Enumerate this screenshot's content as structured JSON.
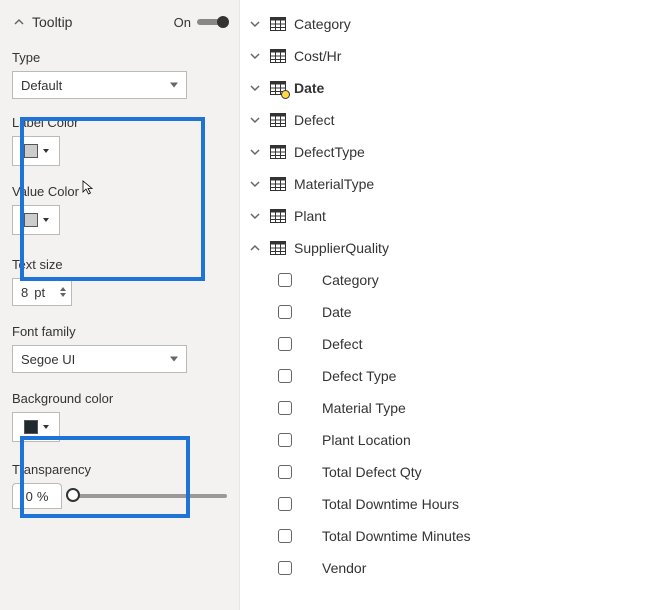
{
  "format": {
    "section_title": "Tooltip",
    "toggle_label": "On",
    "toggle_state": true,
    "type": {
      "label": "Type",
      "value": "Default"
    },
    "label_color": {
      "label": "Label Color",
      "swatch": "#cccccc"
    },
    "value_color": {
      "label": "Value Color",
      "swatch": "#cccccc"
    },
    "text_size": {
      "label": "Text size",
      "value": "8",
      "unit": "pt"
    },
    "font_family": {
      "label": "Font family",
      "value": "Segoe UI"
    },
    "background_color": {
      "label": "Background color",
      "swatch": "#1e2a2f"
    },
    "transparency": {
      "label": "Transparency",
      "value": "0",
      "unit": "%"
    }
  },
  "tables": [
    {
      "name": "Category",
      "expanded": false,
      "highlighted": false
    },
    {
      "name": "Cost/Hr",
      "expanded": false,
      "highlighted": false
    },
    {
      "name": "Date",
      "expanded": false,
      "highlighted": true
    },
    {
      "name": "Defect",
      "expanded": false,
      "highlighted": false
    },
    {
      "name": "DefectType",
      "expanded": false,
      "highlighted": false
    },
    {
      "name": "MaterialType",
      "expanded": false,
      "highlighted": false
    },
    {
      "name": "Plant",
      "expanded": false,
      "highlighted": false
    },
    {
      "name": "SupplierQuality",
      "expanded": true,
      "highlighted": false
    }
  ],
  "supplier_quality_fields": [
    "Category",
    "Date",
    "Defect",
    "Defect Type",
    "Material Type",
    "Plant Location",
    "Total Defect Qty",
    "Total Downtime Hours",
    "Total Downtime Minutes",
    "Vendor"
  ]
}
